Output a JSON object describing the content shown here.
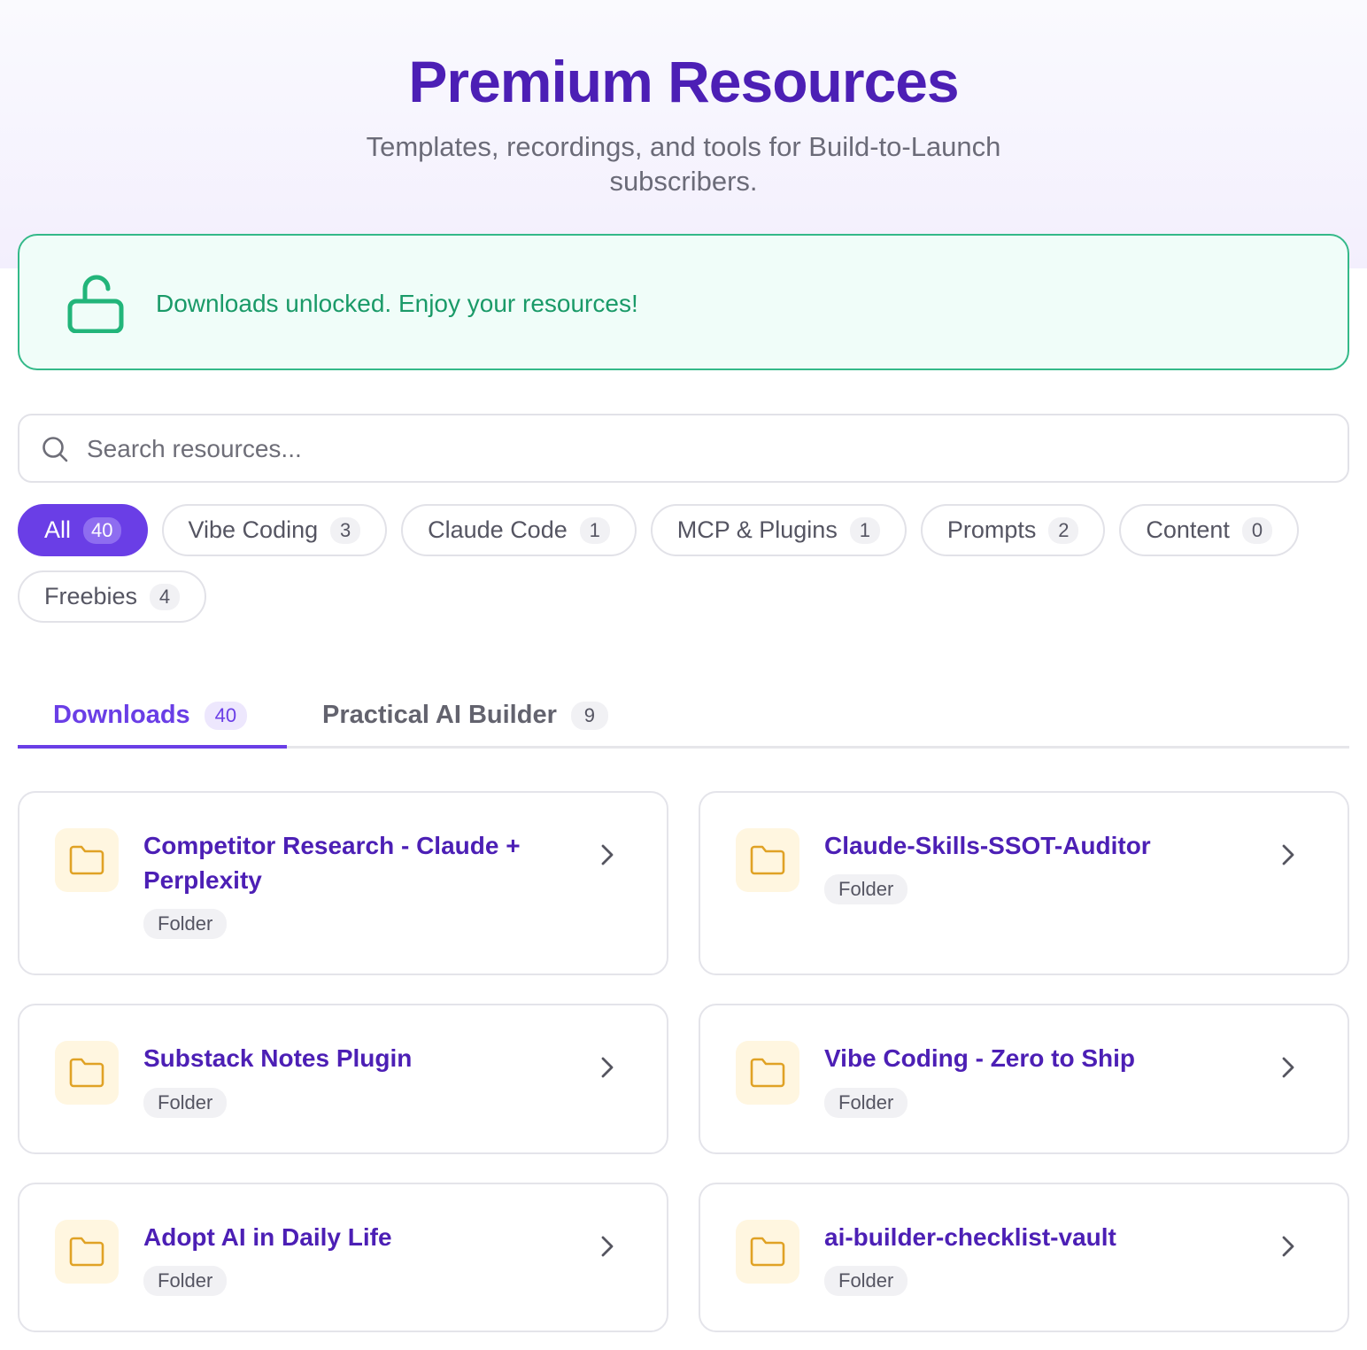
{
  "header": {
    "title": "Premium Resources",
    "subtitle": "Templates, recordings, and tools for Build-to-Launch subscribers."
  },
  "banner": {
    "message": "Downloads unlocked. Enjoy your resources!",
    "icon": "unlock-icon",
    "color": "#1a9a68"
  },
  "search": {
    "placeholder": "Search resources...",
    "value": "",
    "icon": "search-icon"
  },
  "filters": [
    {
      "label": "All",
      "count": "40",
      "active": true
    },
    {
      "label": "Vibe Coding",
      "count": "3",
      "active": false
    },
    {
      "label": "Claude Code",
      "count": "1",
      "active": false
    },
    {
      "label": "MCP & Plugins",
      "count": "1",
      "active": false
    },
    {
      "label": "Prompts",
      "count": "2",
      "active": false
    },
    {
      "label": "Content",
      "count": "0",
      "active": false
    },
    {
      "label": "Freebies",
      "count": "4",
      "active": false
    }
  ],
  "tabs": [
    {
      "label": "Downloads",
      "count": "40",
      "active": true
    },
    {
      "label": "Practical AI Builder",
      "count": "9",
      "active": false
    }
  ],
  "resources": [
    {
      "title": "Competitor Research - Claude + Perplexity",
      "tag": "Folder",
      "icon": "folder-icon"
    },
    {
      "title": "Claude-Skills-SSOT-Auditor",
      "tag": "Folder",
      "icon": "folder-icon"
    },
    {
      "title": "Substack Notes Plugin",
      "tag": "Folder",
      "icon": "folder-icon"
    },
    {
      "title": "Vibe Coding - Zero to Ship",
      "tag": "Folder",
      "icon": "folder-icon"
    },
    {
      "title": "Adopt AI in Daily Life",
      "tag": "Folder",
      "icon": "folder-icon"
    },
    {
      "title": "ai-builder-checklist-vault",
      "tag": "Folder",
      "icon": "folder-icon"
    }
  ],
  "colors": {
    "accent": "#6a3ee6",
    "title": "#4c1fb5",
    "success": "#34b989",
    "folder": "#e0a225"
  }
}
